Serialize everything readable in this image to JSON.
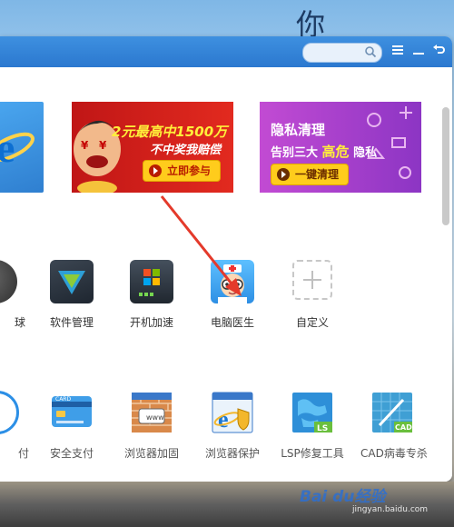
{
  "desktop": {
    "fragment": "你"
  },
  "titlebar": {
    "search_placeholder": ""
  },
  "banners": [
    {
      "title": "2元最高中1500万",
      "subtitle": "不中奖我赔偿",
      "button": "立即参与"
    },
    {
      "title": "隐私清理",
      "subtitle_pre": "告别三大",
      "subtitle_hl": "高危",
      "subtitle_post": "隐私",
      "button": "一键清理"
    }
  ],
  "tools_row1": [
    {
      "label": "球"
    },
    {
      "label": "软件管理"
    },
    {
      "label": "开机加速"
    },
    {
      "label": "电脑医生"
    },
    {
      "label": "自定义"
    }
  ],
  "tools_row2": [
    {
      "label": "付"
    },
    {
      "label": "安全支付"
    },
    {
      "label": "浏览器加固"
    },
    {
      "label": "浏览器保护"
    },
    {
      "label": "LSP修复工具"
    },
    {
      "label": "CAD病毒专杀"
    }
  ],
  "watermark": {
    "text": "Bai du经验",
    "url": "jingyan.baidu.com"
  },
  "colors": {
    "titlebar": "#2f80d3",
    "arrow": "#e43a2b",
    "banner_red": "#d11d16",
    "banner_purple": "#a846cc"
  }
}
